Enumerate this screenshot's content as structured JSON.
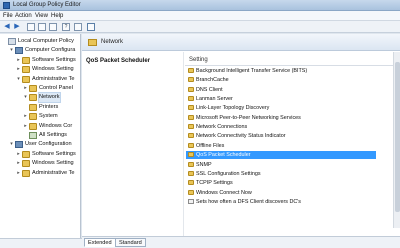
{
  "window": {
    "title": "Local Group Policy Editor"
  },
  "menu": [
    "File",
    "Action",
    "View",
    "Help"
  ],
  "toolbar": {
    "back_icon": "back-arrow-icon",
    "forward_icon": "forward-arrow-icon"
  },
  "tree": [
    {
      "label": "Local Computer Policy",
      "icon": "policy",
      "indent": 0,
      "exp": ""
    },
    {
      "label": "Computer Configura",
      "icon": "computer",
      "indent": 1,
      "exp": "▾"
    },
    {
      "label": "Software Settings",
      "icon": "folder",
      "indent": 2,
      "exp": "▸"
    },
    {
      "label": "Windows Setting",
      "icon": "folder",
      "indent": 2,
      "exp": "▸"
    },
    {
      "label": "Administrative Te",
      "icon": "folder",
      "indent": 2,
      "exp": "▾"
    },
    {
      "label": "Control Panel",
      "icon": "folder",
      "indent": 3,
      "exp": "▸"
    },
    {
      "label": "Network",
      "icon": "folder",
      "indent": 3,
      "exp": "▾",
      "selected": true
    },
    {
      "label": "Printers",
      "icon": "folder",
      "indent": 3,
      "exp": ""
    },
    {
      "label": "System",
      "icon": "folder",
      "indent": 3,
      "exp": "▸"
    },
    {
      "label": "Windows Cor",
      "icon": "folder",
      "indent": 3,
      "exp": "▸"
    },
    {
      "label": "All Settings",
      "icon": "settings",
      "indent": 3,
      "exp": ""
    },
    {
      "label": "User Configuration",
      "icon": "computer",
      "indent": 1,
      "exp": "▾"
    },
    {
      "label": "Software Settings",
      "icon": "folder",
      "indent": 2,
      "exp": "▸"
    },
    {
      "label": "Windows Setting",
      "icon": "folder",
      "indent": 2,
      "exp": "▸"
    },
    {
      "label": "Administrative Te",
      "icon": "folder",
      "indent": 2,
      "exp": "▸"
    }
  ],
  "header": {
    "title": "Network"
  },
  "description": {
    "title": "QoS Packet Scheduler"
  },
  "list": {
    "column": "Setting",
    "items": [
      {
        "label": "Background Intelligent Transfer Service (BITS)",
        "type": "folder"
      },
      {
        "label": "BranchCache",
        "type": "folder"
      },
      {
        "label": "DNS Client",
        "type": "folder"
      },
      {
        "label": "Lanman Server",
        "type": "folder"
      },
      {
        "label": "Link-Layer Topology Discovery",
        "type": "folder"
      },
      {
        "label": "Microsoft Peer-to-Peer Networking Services",
        "type": "folder"
      },
      {
        "label": "Network Connections",
        "type": "folder"
      },
      {
        "label": "Network Connectivity Status Indicator",
        "type": "folder"
      },
      {
        "label": "Offline Files",
        "type": "folder"
      },
      {
        "label": "QoS Packet Scheduler",
        "type": "folder",
        "selected": true
      },
      {
        "label": "SNMP",
        "type": "folder"
      },
      {
        "label": "SSL Configuration Settings",
        "type": "folder"
      },
      {
        "label": "TCPIP Settings",
        "type": "folder"
      },
      {
        "label": "Windows Connect Now",
        "type": "folder"
      },
      {
        "label": "Sets how often a DFS Client discovers DC's",
        "type": "policy"
      }
    ]
  },
  "tabs": [
    {
      "label": "Extended",
      "active": true
    },
    {
      "label": "Standard",
      "active": false
    }
  ]
}
